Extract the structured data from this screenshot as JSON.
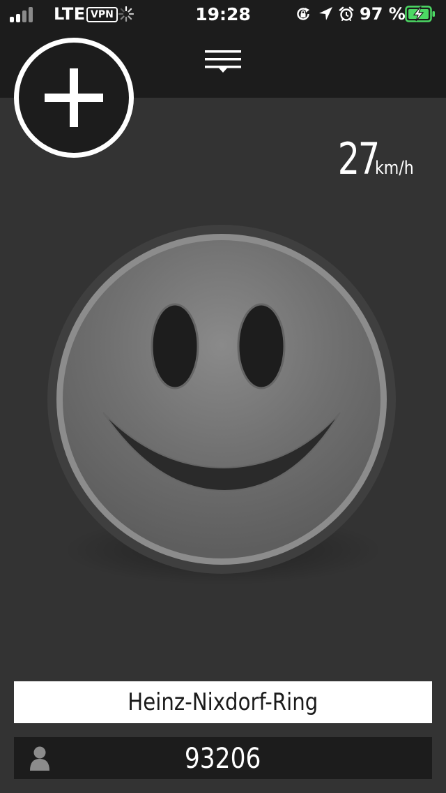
{
  "status_bar": {
    "carrier": "LTE",
    "vpn": "VPN",
    "time": "19:28",
    "battery_percent": "97 %",
    "icons": [
      "signal-icon",
      "loading-spinner-icon",
      "rotation-lock-icon",
      "location-arrow-icon",
      "alarm-icon",
      "battery-charging-icon"
    ]
  },
  "toolbar": {
    "menu_icon": "hamburger-menu-icon",
    "add_icon": "plus-icon"
  },
  "speed": {
    "value": "27",
    "unit": "km/h"
  },
  "main": {
    "indicator_icon": "smiley-face-icon"
  },
  "location": {
    "name": "Heinz-Nixdorf-Ring"
  },
  "riders": {
    "icon": "user-icon",
    "count": "93206"
  },
  "colors": {
    "background": "#333333",
    "bar": "#1c1c1c",
    "battery_green": "#4cd964"
  }
}
